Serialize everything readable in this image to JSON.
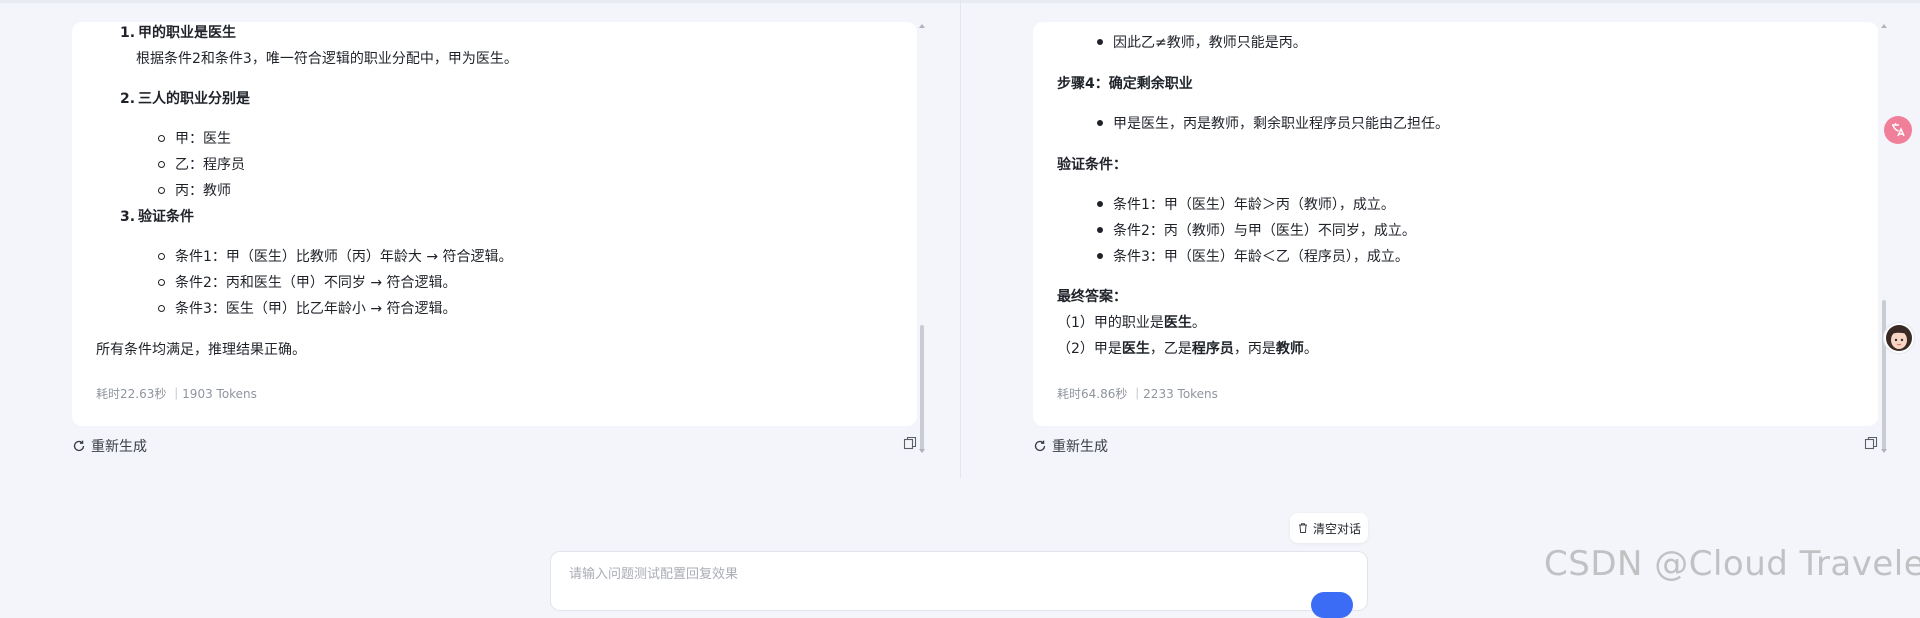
{
  "left_panel": {
    "item1_num": "1.",
    "item1_title": "甲的职业是医生",
    "item1_desc": "根据条件2和条件3，唯一符合逻辑的职业分配中，甲为医生。",
    "item2_num": "2.",
    "item2_title": "三人的职业分别是",
    "professions": [
      "甲：医生",
      "乙：程序员",
      "丙：教师"
    ],
    "item3_num": "3.",
    "item3_title": "验证条件",
    "conditions": [
      "条件1：甲（医生）比教师（丙）年龄大 → 符合逻辑。",
      "条件2：丙和医生（甲）不同岁 → 符合逻辑。",
      "条件3：医生（甲）比乙年龄小 → 符合逻辑。"
    ],
    "conclusion": "所有条件均满足，推理结果正确。",
    "meta": "耗时22.63秒 ｜1903 Tokens",
    "regenerate_label": "重新生成"
  },
  "right_panel": {
    "cut_line": "因此乙≠教师，教师只能是丙。",
    "step4_title": "步骤4：确定剩余职业",
    "step4_bullet": "甲是医生，丙是教师，剩余职业程序员只能由乙担任。",
    "verify_title": "验证条件：",
    "verify_items": [
      "条件1：甲（医生）年龄＞丙（教师），成立。",
      "条件2：丙（教师）与甲（医生）不同岁，成立。",
      "条件3：甲（医生）年龄＜乙（程序员），成立。"
    ],
    "final_title": "最终答案：",
    "final_1_prefix": "（1）甲的职业是",
    "final_1_bold": "医生",
    "final_1_suffix": "。",
    "final_2_prefix": "（2）甲是",
    "final_2_b1": "医生",
    "final_2_mid1": "，乙是",
    "final_2_b2": "程序员",
    "final_2_mid2": "，丙是",
    "final_2_b3": "教师",
    "final_2_suffix": "。",
    "meta": "耗时64.86秒 ｜2233 Tokens",
    "regenerate_label": "重新生成"
  },
  "footer": {
    "clear_label": "清空对话",
    "input_placeholder": "请输入问题测试配置回复效果",
    "input_value": ""
  },
  "watermark": "CSDN @Cloud Traveler",
  "colors": {
    "background": "#f3f5fa",
    "card": "#ffffff",
    "accent": "#3b6cf6",
    "meta_text": "#8f959e",
    "avatar_badge": "#f07f9a"
  },
  "icons": [
    "refresh-icon",
    "copy-icon",
    "trash-icon",
    "translate-icon",
    "assistant-avatar-icon"
  ]
}
